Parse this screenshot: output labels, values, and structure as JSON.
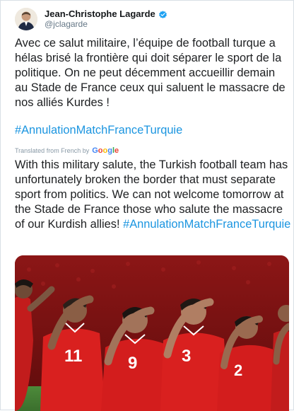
{
  "author": {
    "name": "Jean-Christophe Lagarde",
    "handle": "@jclagarde",
    "avatar_icon": "profile-photo",
    "verified_icon": "verified-badge-icon",
    "verified_color": "#1da1f2"
  },
  "tweet": {
    "text_fr": "Avec ce salut militaire, l’équipe de football turque a hélas brisé la frontière qui doit séparer le sport de la politique. On ne peut décemment accueillir demain au Stade de France ceux qui saluent le massacre de nos alliés Kurdes !",
    "hashtag_fr": "#AnnulationMatchFranceTurquie",
    "translated_label": "Translated from French by",
    "translation_provider": "Google",
    "text_en": "With this military salute, the Turkish football team has unfortunately broken the border that must separate sport from politics. We can not welcome tomorrow at the Stade de France those who salute the massacre of our Kurdish allies!",
    "hashtag_en": "#AnnulationMatchFranceTurquie"
  },
  "photo": {
    "jersey_numbers": [
      "11",
      "9",
      "3",
      "2"
    ]
  },
  "colors": {
    "hashtag": "#1b95e0",
    "text": "#1d1f21",
    "muted": "#657786",
    "jersey_red": "#d9201f"
  }
}
